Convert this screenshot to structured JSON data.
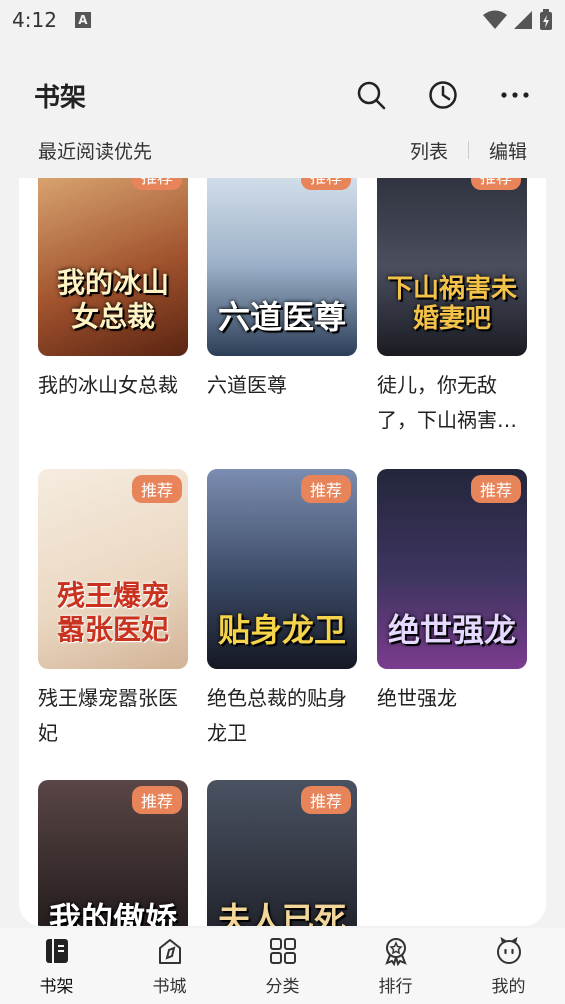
{
  "status": {
    "time": "4:12",
    "a_icon": "A"
  },
  "header": {
    "title": "书架"
  },
  "sortbar": {
    "label": "最近阅读优先",
    "list": "列表",
    "edit": "编辑"
  },
  "books": [
    {
      "title": "我的冰山女总裁",
      "cover_text": "我的冰山女总裁",
      "badge": "推荐",
      "colors": [
        "#d58a3c",
        "#7a3a1e"
      ]
    },
    {
      "title": "六道医尊",
      "cover_text": "六道医尊",
      "badge": "推荐",
      "colors": [
        "#c9d6e4",
        "#2c3e57"
      ]
    },
    {
      "title": "徒儿，你无敌了，下山祸害未婚妻吧",
      "cover_text": "下山祸害未婚妻吧",
      "badge": "推荐",
      "colors": [
        "#3a3d4a",
        "#b8862b"
      ]
    },
    {
      "title": "残王爆宠嚣张医妃",
      "cover_text": "残王爆宠嚣张医妃",
      "badge": "推荐",
      "colors": [
        "#f1e4d2",
        "#b93a2c"
      ]
    },
    {
      "title": "绝色总裁的贴身龙卫",
      "cover_text": "贴身龙卫",
      "badge": "推荐",
      "colors": [
        "#5c6f8e",
        "#1d2233"
      ]
    },
    {
      "title": "绝世强龙",
      "cover_text": "绝世强龙",
      "badge": "推荐",
      "colors": [
        "#2c2f4a",
        "#7a3c8e"
      ]
    },
    {
      "title": "",
      "cover_text": "我的傲娇",
      "badge": "推荐",
      "colors": [
        "#4a3a3a",
        "#1f1a1a"
      ]
    },
    {
      "title": "",
      "cover_text": "夫人已死",
      "badge": "推荐",
      "colors": [
        "#3a4250",
        "#1b1c22"
      ]
    }
  ],
  "nav": [
    {
      "label": "书架",
      "icon": "bookshelf-icon",
      "active": true
    },
    {
      "label": "书城",
      "icon": "bookstore-icon",
      "active": false
    },
    {
      "label": "分类",
      "icon": "category-icon",
      "active": false
    },
    {
      "label": "排行",
      "icon": "ranking-icon",
      "active": false
    },
    {
      "label": "我的",
      "icon": "profile-icon",
      "active": false
    }
  ]
}
